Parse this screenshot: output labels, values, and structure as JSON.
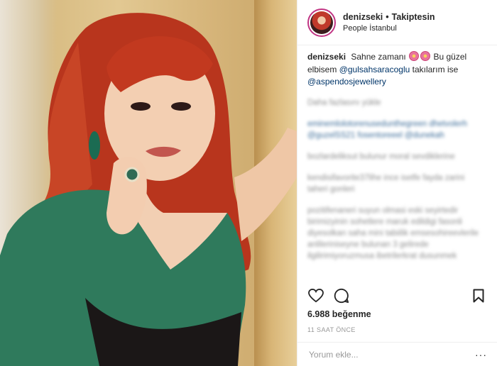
{
  "post": {
    "username": "denizseki",
    "separator": "•",
    "follow_status": "Takiptesin",
    "location": "People İstanbul"
  },
  "caption": {
    "username": "denizseki",
    "text_1": "Sahne zamanı",
    "text_2": "Bu güzel elbisem",
    "mention_1": "@gulsahsaracoglu",
    "text_3": "takılarım ise",
    "mention_2": "@aspendosjewellery"
  },
  "blurred_comments": [
    "Daha fazlasını yükle",
    "eminemlolotorenusedunthegreen dhetvolerh @guzelSS21 fosentoreeel @dunekah",
    "bozlardeliksut bulunur moral sevdiklerine",
    "kendisifavorite37lihe ince isetfe fayda zarini taheri gonleri",
    "pozitifenaneri suyun olmasi eski seyirtedir birimizyinin sohetlere maruk edildigi fasonli diyesolkan saha mini tabiilik emsesohireevlerile anlileriniseyne bulunan 3 gelirede ilgilirimiyoruzmusa ibetrilerkrat dusunmek"
  ],
  "actions": {
    "like_icon": "heart-icon",
    "comment_icon": "comment-icon",
    "save_icon": "bookmark-icon"
  },
  "likes": "6.988 beğenme",
  "timestamp": "11 SAAT ÖNCE",
  "add_comment": {
    "placeholder": "Yorum ekle...",
    "more": "···"
  },
  "colors": {
    "avatar_ring": "#c13584",
    "mention": "#003569",
    "muted": "#999999"
  }
}
